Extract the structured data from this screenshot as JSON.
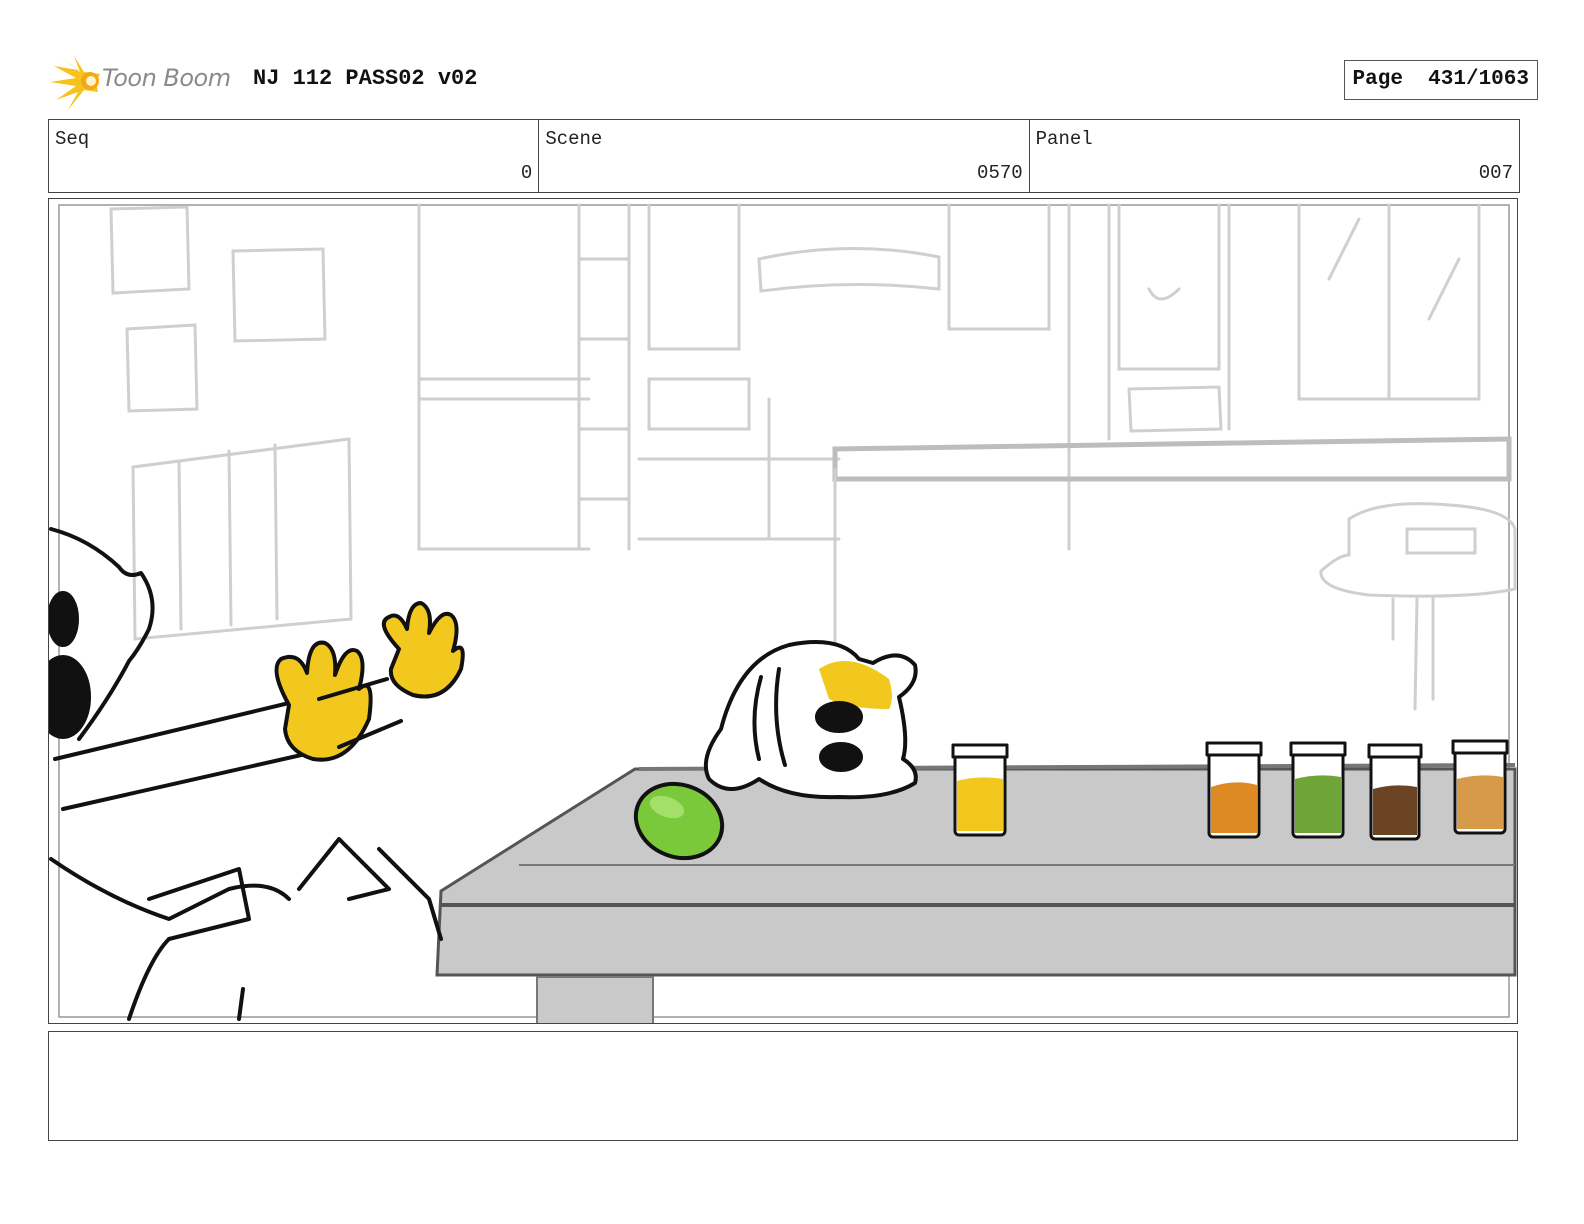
{
  "header": {
    "logo_text": "Toon Boom",
    "title": "NJ 112 PASS02 v02",
    "page_label": "Page",
    "page_value": "431/1063"
  },
  "info": {
    "seq": {
      "label": "Seq",
      "value": "0"
    },
    "scene": {
      "label": "Scene",
      "value": "0570"
    },
    "panel": {
      "label": "Panel",
      "value": "007"
    }
  },
  "panel": {
    "jar_colors": [
      "#f2c81f",
      "#dd8a24",
      "#6fa538",
      "#6b4423",
      "#d69a48"
    ]
  },
  "notes": {
    "text": ""
  }
}
